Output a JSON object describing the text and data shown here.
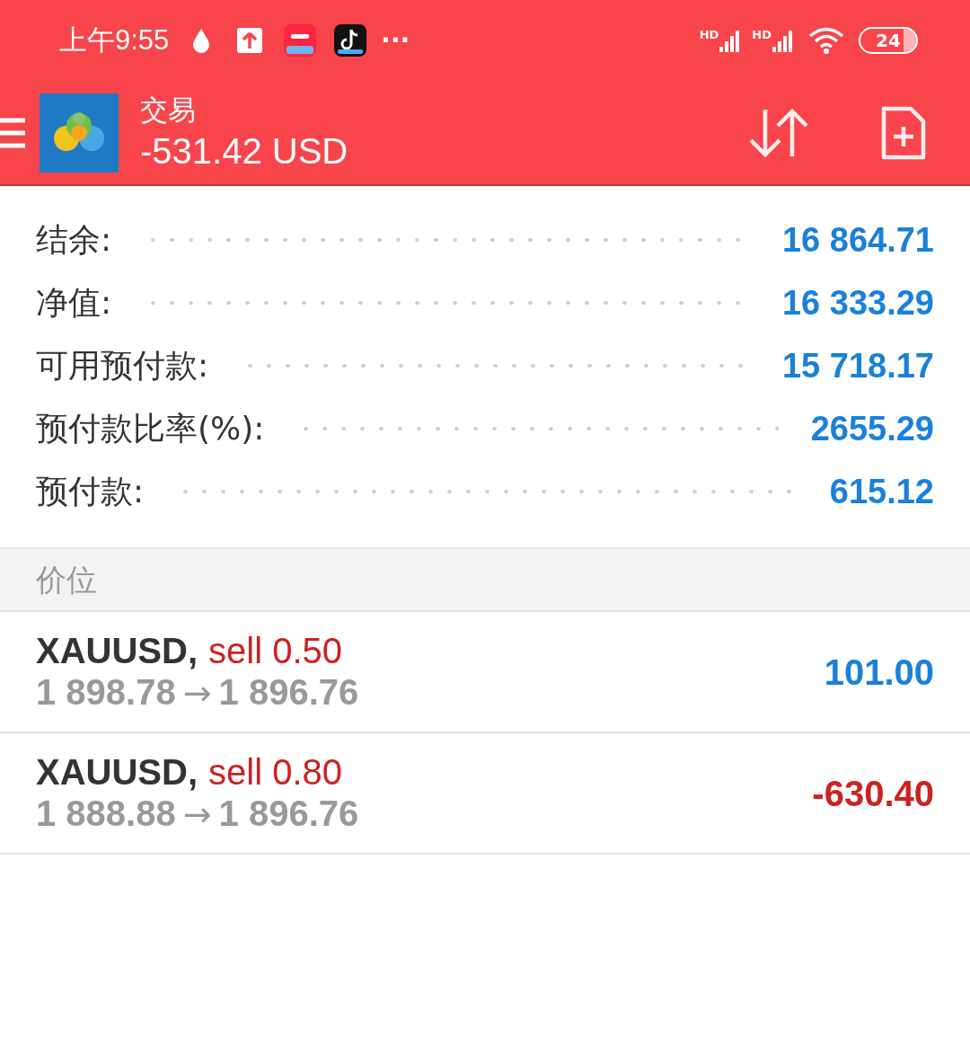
{
  "status_bar": {
    "time": "上午9:55",
    "more": "···",
    "signals": [
      {
        "label": "HD"
      },
      {
        "label": "HD"
      }
    ],
    "battery": "24"
  },
  "header": {
    "title": "交易",
    "subtitle": "-531.42 USD"
  },
  "summary": [
    {
      "label": "结余:",
      "value": "16 864.71"
    },
    {
      "label": "净值:",
      "value": "16 333.29"
    },
    {
      "label": "可用预付款:",
      "value": "15 718.17"
    },
    {
      "label": "预付款比率(%):",
      "value": "2655.29"
    },
    {
      "label": "预付款:",
      "value": "615.12"
    }
  ],
  "section": "价位",
  "positions": [
    {
      "symbol": "XAUUSD,",
      "action": "sell 0.50",
      "open": "1 898.78",
      "arrow": "→",
      "current": "1 896.76",
      "profit": "101.00",
      "loss": false
    },
    {
      "symbol": "XAUUSD,",
      "action": "sell 0.80",
      "open": "1 888.88",
      "arrow": "→",
      "current": "1 896.76",
      "profit": "-630.40",
      "loss": true
    }
  ]
}
